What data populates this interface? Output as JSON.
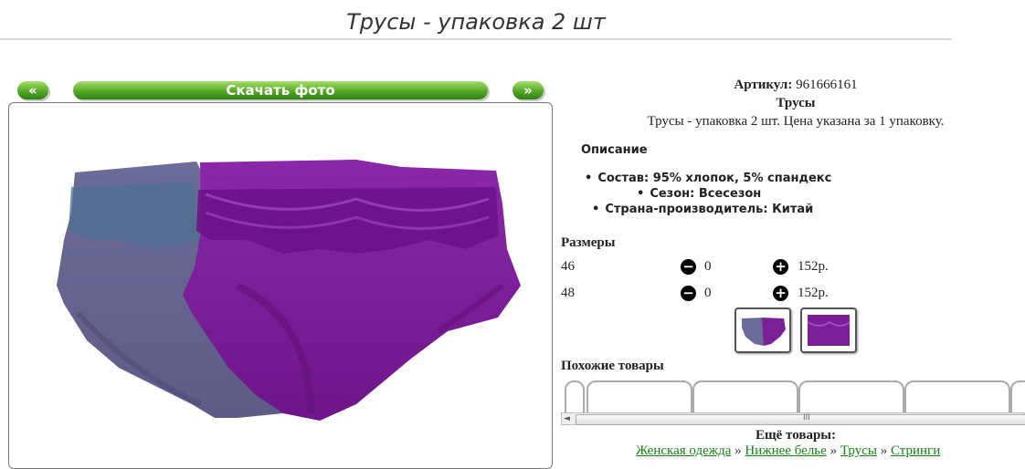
{
  "page": {
    "title": "Трусы - упаковка 2 шт"
  },
  "gallery": {
    "prev_label": "«",
    "next_label": "»",
    "download_label": "Скачать фото"
  },
  "product": {
    "article_label": "Артикул:",
    "article_value": "961666161",
    "name": "Трусы",
    "description": "Трусы - упаковка 2 шт. Цена указана за 1 упаковку."
  },
  "features": {
    "heading": "Описание",
    "items": [
      "Состав: 95% хлопок, 5% спандекс",
      "Сезон: Всесезон",
      "Страна-производитель: Китай"
    ]
  },
  "sizes": {
    "heading": "Размеры",
    "rows": [
      {
        "size": "46",
        "qty": "0",
        "price": "152р."
      },
      {
        "size": "48",
        "qty": "0",
        "price": "152р."
      }
    ],
    "minus_icon": "minus-circle-icon",
    "plus_icon": "plus-circle-icon"
  },
  "similar": {
    "heading": "Похожие товары",
    "scroll_left": "◄",
    "scroll_grip": "III"
  },
  "more": {
    "heading": "Ещё товары:",
    "links": [
      "Женская одежда",
      "Нижнее белье",
      "Трусы",
      "Стринги"
    ]
  },
  "colors": {
    "accent_green": "#55a826",
    "link_green": "#1a7f1a",
    "gray_panty": "#6f6f9a",
    "purple_panty": "#7a1f95"
  }
}
